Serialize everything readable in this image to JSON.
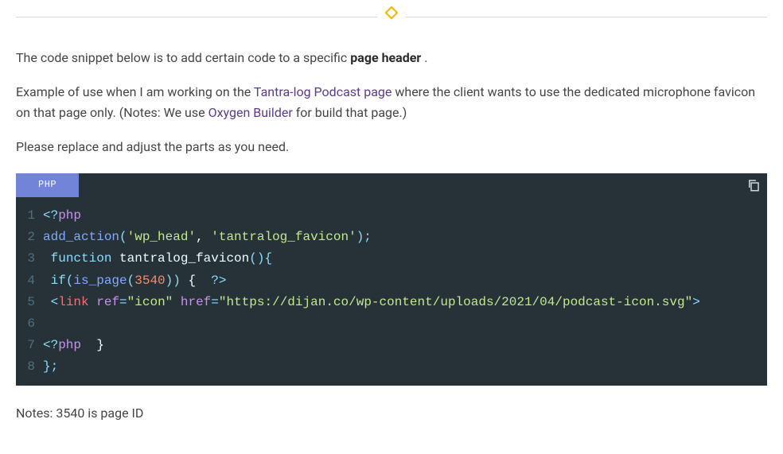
{
  "intro": {
    "p1_before": "The code snippet below is to add certain code to a specific ",
    "p1_strong": "page header",
    "p1_after": " .",
    "p2_a": "Example of use when I am working on the ",
    "p2_link1": "Tantra-log Podcast page",
    "p2_b": " where the client wants to use the dedicated microphone favicon on that page only. (Notes: We use ",
    "p2_link2": "Oxygen Builder",
    "p2_c": " for build that page.)",
    "p3": "Please replace and adjust the parts as you need."
  },
  "code": {
    "lang": "PHP",
    "lines": {
      "l1": {
        "n": "1",
        "a": "<?",
        "b": "php"
      },
      "l2": {
        "n": "2",
        "fn": "add_action",
        "p1": "(",
        "s1": "'wp_head'",
        "c": ", ",
        "s2": "'tantralog_favicon'",
        "p2": ");"
      },
      "l3": {
        "n": "3",
        "indent": " ",
        "kw": "function ",
        "name": "tantralog_favicon",
        "tail": "(){"
      },
      "l4": {
        "n": "4",
        "indent": " ",
        "kw": "if",
        "p1": "(",
        "fn": "is_page",
        "p2": "(",
        "num": "3540",
        "p3": "))",
        "br": " {  ",
        "close": "?>"
      },
      "l5": {
        "n": "5",
        "indent": " ",
        "open": "<",
        "tag": "link",
        "sp": " ",
        "a1": "ref",
        "eq1": "=",
        "v1": "\"icon\"",
        "sp2": " ",
        "a2": "href",
        "eq2": "=",
        "v2": "\"https://dijan.co/wp-content/uploads/2021/04/podcast-icon.svg\"",
        "end": ">"
      },
      "l6": {
        "n": "6"
      },
      "l7": {
        "n": "7",
        "a": "<?",
        "b": "php",
        "c": "  }"
      },
      "l8": {
        "n": "8",
        "t": "};"
      }
    }
  },
  "notes": "Notes: 3540 is page ID"
}
